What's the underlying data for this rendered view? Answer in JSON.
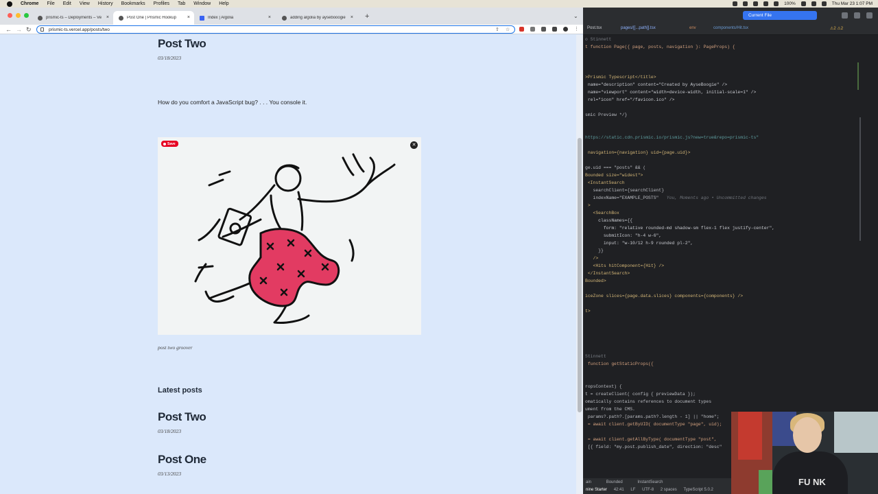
{
  "menubar": {
    "app": "Chrome",
    "items": [
      "File",
      "Edit",
      "View",
      "History",
      "Bookmarks",
      "Profiles",
      "Tab",
      "Window",
      "Help"
    ],
    "battery": "100%",
    "clock": "Thu Mar 23  1:07 PM"
  },
  "browser": {
    "tabs": [
      {
        "title": "prismic-ts – Deployments – Ve",
        "close": "×"
      },
      {
        "title": "Post One | Prismic Hookup",
        "close": "×"
      },
      {
        "title": "Index | Algolia",
        "close": "×"
      },
      {
        "title": "adding algolia by aysebooogie",
        "close": "×"
      }
    ],
    "new_tab": "+",
    "url": "prismic-ts.vercel.app/posts/two",
    "nav": {
      "back": "←",
      "forward": "→",
      "reload": "↻"
    }
  },
  "post": {
    "title": "Post Two",
    "date": "03/18/2023",
    "body": "How do you comfort a JavaScript bug? . . . You console it.",
    "image_save": "Save",
    "caption": "post two groover"
  },
  "latest": {
    "heading": "Latest posts",
    "items": [
      {
        "title": "Post Two",
        "date": "03/18/2023"
      },
      {
        "title": "Post One",
        "date": "03/13/2023"
      }
    ]
  },
  "ide": {
    "current_file": "Current File",
    "tabs": [
      "Post.tsx",
      "pages/[[...path]].tsx",
      "env",
      "components/Hit.tsx"
    ],
    "warnings": "⚠2  ⚠2",
    "code": [
      "o Stinnett",
      "t function Page({ page, posts, navigation }: PageProps) {",
      "",
      "",
      "",
      ">Prismic Typescript</title>",
      " name=\"description\" content=\"Created by AyseBoogie\" />",
      " name=\"viewport\" content=\"width=device-width, initial-scale=1\" />",
      " rel=\"icon\" href=\"/favicon.ico\" />",
      "",
      "smic Preview */}",
      "",
      "",
      "https://static.cdn.prismic.io/prismic.js?new=true&repo=prismic-ts\"",
      "",
      " navigation={navigation} uid={page.uid}>",
      "",
      "ge.uid === \"posts\" && (",
      "Bounded size=\"widest\">",
      " <InstantSearch",
      "   searchClient={searchClient}",
      "   indexName=\"EXAMPLE_POSTS\"",
      " >",
      "   <SearchBox",
      "     classNames={{",
      "       form: \"relative rounded-md shadow-sm flex-1 flex justify-center\",",
      "       submitIcon: \"h-4 w-6\",",
      "       input: \"w-10/12 h-9 rounded pl-2\",",
      "     }}",
      "   />",
      "   <Hits hitComponent={Hit} />",
      " </InstantSearch>",
      "Bounded>",
      "",
      "iceZone slices={page.data.slices} components={components} />",
      "",
      "t>",
      "",
      "",
      "",
      "",
      "",
      "Stinnett",
      " function getStaticProps({",
      "",
      "",
      "ropsContext) {",
      "t = createClient( config { previewData });",
      "omatically contains references to document types",
      "ument from the CMS.",
      " params?.path?.[params.path?.length - 1] || \"home\";",
      " = await client.getByUID( documentType \"page\", uid);",
      "",
      " = await client.getAllByType( documentType \"post\",",
      " [{ field: \"my.post.publish_date\", direction: \"desc\""
    ],
    "inline_hint": "You, Moments ago • Uncommitted changes",
    "breadcrumb": [
      "ain",
      "Bounded",
      "InstantSearch"
    ],
    "status": [
      "nine Starter",
      "42:41",
      "LF",
      "UTF-8",
      "2 spaces",
      "TypeScript 5.0.2"
    ]
  },
  "webcam": {
    "shirt_text": "FU NK"
  }
}
